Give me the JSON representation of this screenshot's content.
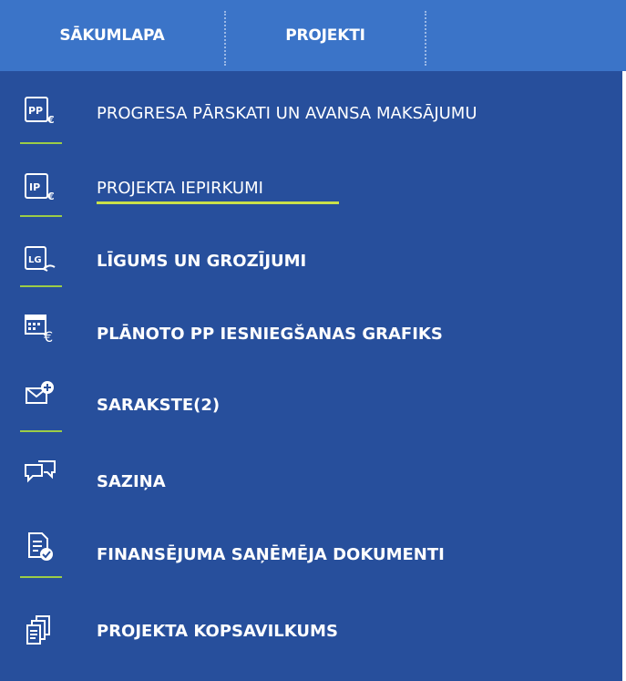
{
  "topnav": {
    "home_label": "SĀKUMLAPA",
    "projects_label": "PROJEKTI"
  },
  "menu": {
    "items": [
      {
        "label": "PROGRESA PĀRSKATI UN AVANSA MAKSĀJUMU",
        "icon": "pp-euro-icon"
      },
      {
        "label": "PROJEKTA IEPIRKUMI",
        "icon": "ip-euro-icon",
        "active": true
      },
      {
        "label": "LĪGUMS UN GROZĪJUMI",
        "icon": "lg-contract-icon"
      },
      {
        "label": "PLĀNOTO PP IESNIEGŠANAS GRAFIKS",
        "icon": "calendar-euro-icon"
      },
      {
        "label": "SARAKSTE(2)",
        "icon": "envelope-plus-icon"
      },
      {
        "label": "SAZIŅA",
        "icon": "chat-bubbles-icon"
      },
      {
        "label": "FINANSĒJUMA SAŅĒMĒJA DOKUMENTI",
        "icon": "document-check-icon"
      },
      {
        "label": "PROJEKTA KOPSAVILKUMS",
        "icon": "documents-stack-icon"
      }
    ]
  },
  "colors": {
    "topbar": "#3b74c8",
    "menu_bg": "#274f9c",
    "divider": "#9ccd46",
    "active_underline": "#c9e04a"
  }
}
